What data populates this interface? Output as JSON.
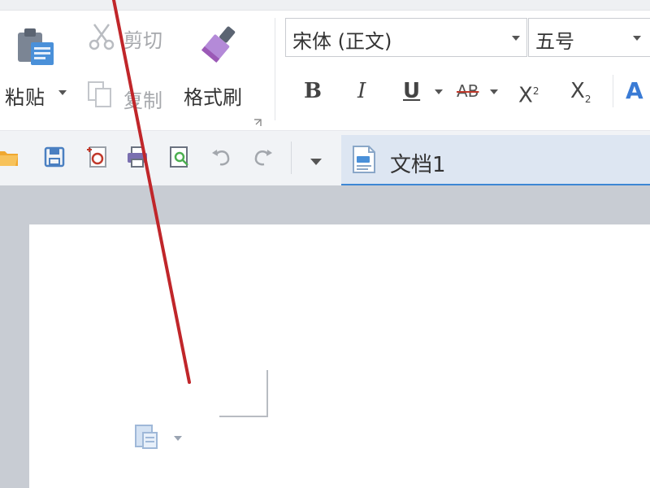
{
  "clipboard": {
    "paste_label": "粘贴",
    "cut_label": "剪切",
    "copy_label": "复制",
    "format_painter_label": "格式刷"
  },
  "font": {
    "name": "宋体 (正文)",
    "size": "五号"
  },
  "format_buttons": {
    "bold": "B",
    "italic": "I",
    "underline": "U",
    "strikethrough": "AB",
    "superscript_base": "X",
    "superscript_mark": "2",
    "subscript_base": "X",
    "subscript_mark": "2",
    "text_effect": "A"
  },
  "document_tabs": [
    {
      "label": "文档1",
      "active": true
    }
  ],
  "colors": {
    "accent": "#3d86d4",
    "annotation": "#c0262a",
    "disabled_text": "#a6a8ac",
    "format_painter": "#9b59b6"
  },
  "icons": {
    "quick_access": [
      "open-folder-icon",
      "save-icon",
      "export-pdf-icon",
      "print-icon",
      "print-preview-icon",
      "undo-icon",
      "redo-icon"
    ]
  }
}
